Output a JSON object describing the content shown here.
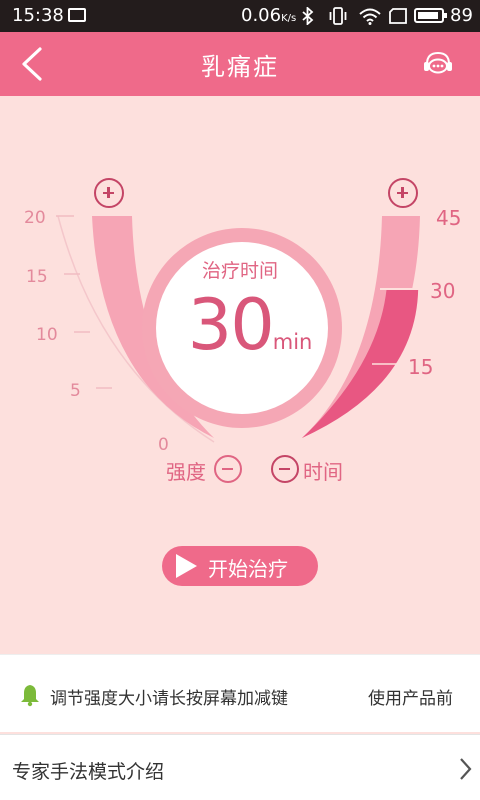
{
  "status_bar": {
    "time": "15:38",
    "network_speed": "0.06",
    "speed_unit": "K/s",
    "battery_level": "89",
    "battery_fraction": 0.89
  },
  "nav": {
    "title": "乳痛症"
  },
  "gauge": {
    "center_label": "治疗时间",
    "value": "30",
    "unit": "min",
    "intensity_ticks": [
      "20",
      "15",
      "10",
      "5",
      "0"
    ],
    "time_ticks": [
      "45",
      "30",
      "15"
    ],
    "intensity_label": "强度",
    "time_label": "时间"
  },
  "start_button": {
    "label": "开始治疗"
  },
  "tip": {
    "text": "调节强度大小请长按屏幕加减键",
    "marquee": "使用产品前"
  },
  "intro": {
    "label": "专家手法模式介绍"
  },
  "colors": {
    "accent": "#ef6a8a",
    "accent_dark": "#e85782",
    "background": "#fde0dd",
    "light_pink": "#f6a5b5",
    "bell_green": "#7cba3a"
  }
}
